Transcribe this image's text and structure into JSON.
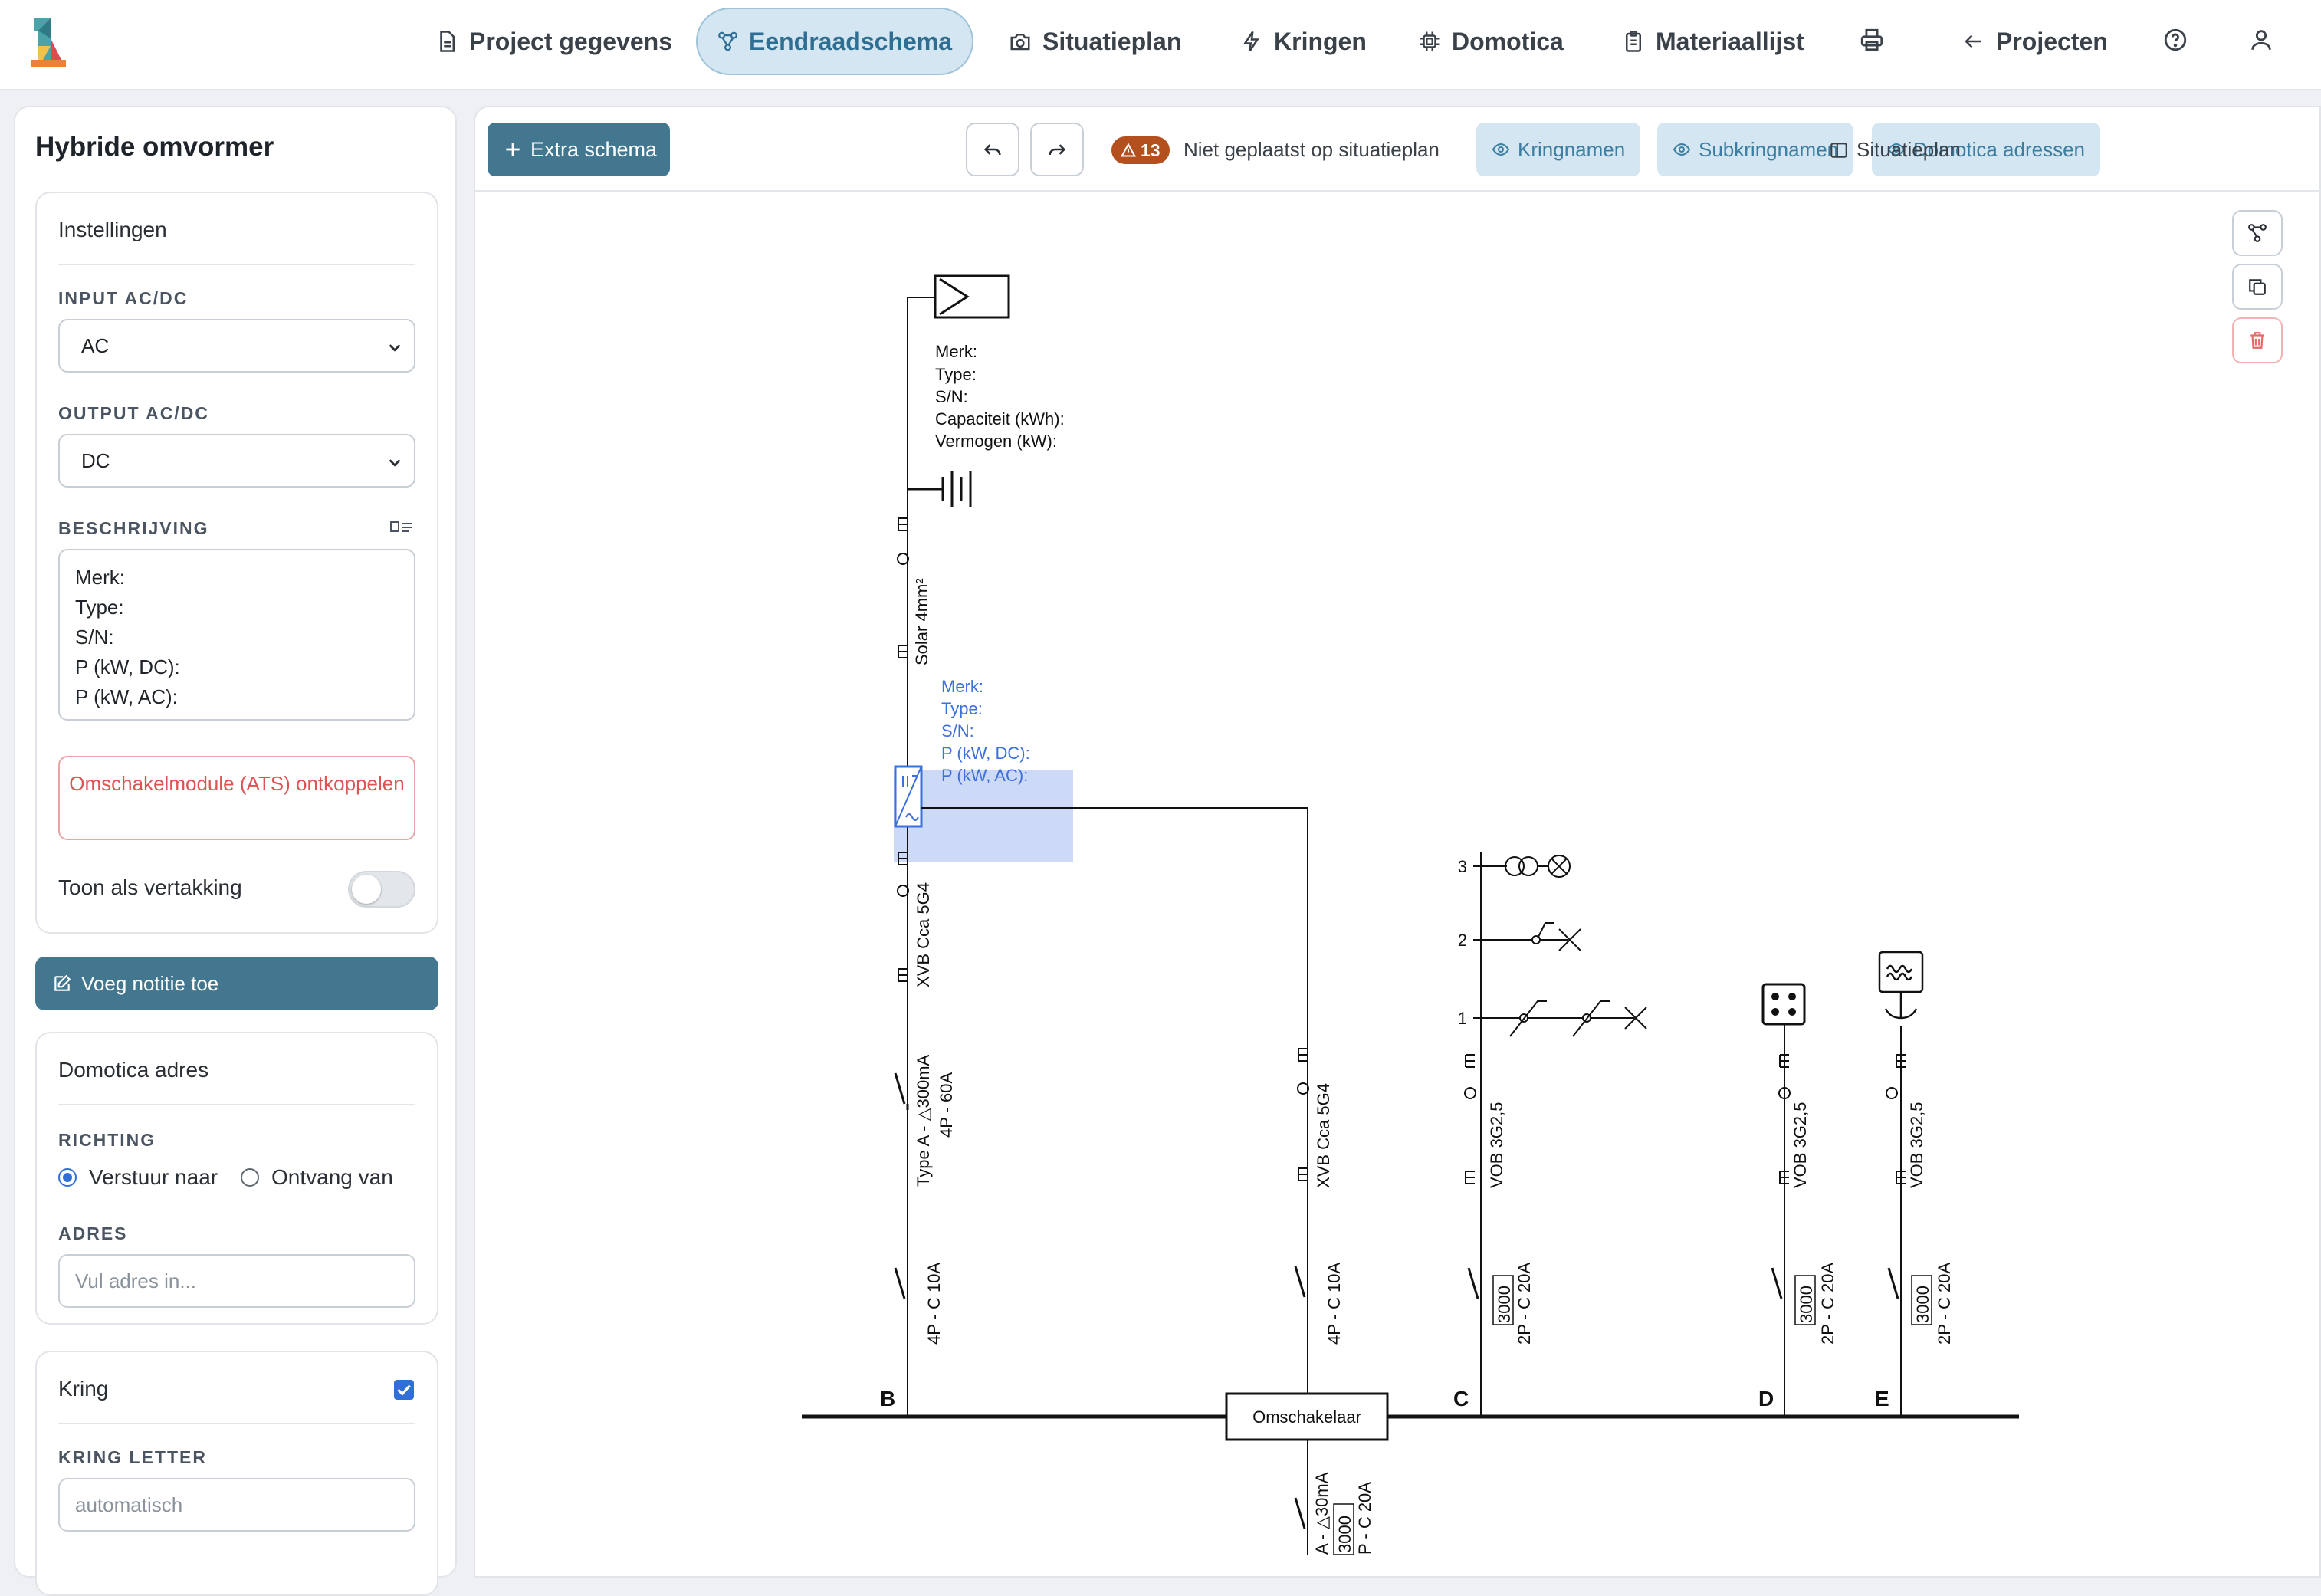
{
  "nav": {
    "items": [
      {
        "label": "Project gegevens",
        "icon": "document-icon"
      },
      {
        "label": "Eendraadschema",
        "icon": "schema-icon",
        "active": true
      },
      {
        "label": "Situatieplan",
        "icon": "camera-icon"
      },
      {
        "label": "Kringen",
        "icon": "lightning-icon"
      },
      {
        "label": "Domotica",
        "icon": "chip-icon"
      },
      {
        "label": "Materiaallijst",
        "icon": "clipboard-icon"
      }
    ],
    "projects_label": "Projecten"
  },
  "left_panel": {
    "title": "Hybride omvormer",
    "settings": {
      "title": "Instellingen",
      "input_label": "INPUT AC/DC",
      "input_value": "AC",
      "output_label": "OUTPUT AC/DC",
      "output_value": "DC",
      "description_label": "BESCHRIJVING",
      "description_value": "Merk:\nType:\nS/N:\nP (kW, DC):\nP (kW, AC):",
      "ats_button": "Omschakelmodule (ATS) ontkoppelen",
      "branch_label": "Toon als vertakking",
      "branch_on": false
    },
    "note_button": "Voeg notitie toe",
    "domotica": {
      "title": "Domotica adres",
      "direction_label": "RICHTING",
      "send_label": "Verstuur naar",
      "receive_label": "Ontvang van",
      "address_label": "ADRES",
      "address_placeholder": "Vul adres in..."
    },
    "kring": {
      "title": "Kring",
      "checked": true,
      "letter_label": "KRING LETTER",
      "letter_placeholder": "automatisch"
    }
  },
  "toolbar": {
    "extra_schema": "Extra schema",
    "warning_count": "13",
    "warning_text": "Niet geplaatst op situatieplan",
    "kringnamen": "Kringnamen",
    "subkringnamen": "Subkringnamen",
    "domotica_adressen": "Domotica adressen",
    "situatieplan": "Situatieplan"
  },
  "schematic": {
    "battery_info": [
      "Merk:",
      "Type:",
      "S/N:",
      "Capaciteit (kWh):",
      "Vermogen (kW):"
    ],
    "inverter_info": [
      "Merk:",
      "Type:",
      "S/N:",
      "P (kW, DC):",
      "P (kW, AC):"
    ],
    "cable_solar": "Solar 4mm²",
    "cable_xvb_b": "XVB Cca 5G4",
    "rcd_b_line1": "Type A - △300mA",
    "rcd_b_line2": "4P - 60A",
    "breaker_b": "4P - C 10A",
    "cable_xvb_omsch": "XVB Cca 5G4",
    "breaker_omsch": "4P - C 10A",
    "cable_c": "VOB 3G2,5",
    "breaker_c": "2P - C 20A",
    "cable_d": "VOB 3G2,5",
    "breaker_d": "2P - C 20A",
    "cable_e": "VOB 3G2,5",
    "breaker_e": "2P - C 20A",
    "rating_box": "3000",
    "circuit_c_points": [
      "3",
      "2",
      "1"
    ],
    "letters": [
      "B",
      "C",
      "D",
      "E"
    ],
    "omschakelaar": "Omschakelaar",
    "bottom_rcd": "A - △30mA",
    "bottom_breaker": "P - C 20A"
  },
  "colors": {
    "primary": "#42778f",
    "active_nav_bg": "#d3e6f1",
    "selection": "#3d6fe0",
    "warning": "#b4501e",
    "danger": "#de5454"
  }
}
